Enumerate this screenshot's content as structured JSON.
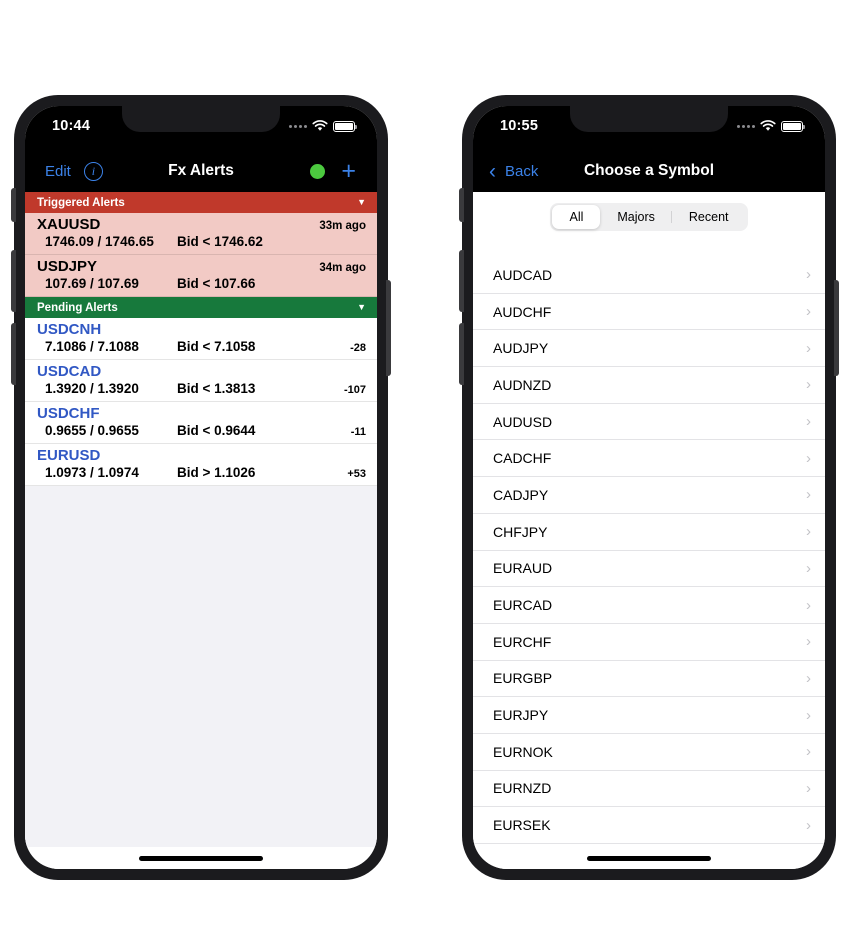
{
  "colors": {
    "triggered_header_bg": "#c0392b",
    "triggered_row_bg": "#f2cac5",
    "pending_header_bg": "#17793c",
    "accent_blue": "#3b82e8",
    "status_dot_green": "#4cc93f",
    "symbol_blue": "#3158c4",
    "page_bg": "#ffffff",
    "list_fill_bg": "#f2f2f6"
  },
  "phone_left": {
    "status_bar": {
      "time": "10:44",
      "signal_icon": "signal-dots-icon",
      "wifi_icon": "wifi-icon",
      "battery_icon": "battery-icon"
    },
    "nav": {
      "edit_label": "Edit",
      "info_icon": "info-circle-icon",
      "info_glyph": "i",
      "title": "Fx Alerts",
      "status_dot_icon": "connection-status-dot-icon",
      "add_label": "+"
    },
    "sections": [
      {
        "id": "triggered",
        "title": "Triggered Alerts",
        "caret": "▼",
        "rows": [
          {
            "symbol": "XAUUSD",
            "ago": "33m ago",
            "price": "1746.09 / 1746.65",
            "condition": "Bid < 1746.62",
            "pips": ""
          },
          {
            "symbol": "USDJPY",
            "ago": "34m ago",
            "price": "107.69 / 107.69",
            "condition": "Bid < 107.66",
            "pips": ""
          }
        ]
      },
      {
        "id": "pending",
        "title": "Pending Alerts",
        "caret": "▼",
        "rows": [
          {
            "symbol": "USDCNH",
            "ago": "",
            "price": "7.1086 / 7.1088",
            "condition": "Bid < 7.1058",
            "pips": "-28"
          },
          {
            "symbol": "USDCAD",
            "ago": "",
            "price": "1.3920 / 1.3920",
            "condition": "Bid < 1.3813",
            "pips": "-107"
          },
          {
            "symbol": "USDCHF",
            "ago": "",
            "price": "0.9655 / 0.9655",
            "condition": "Bid < 0.9644",
            "pips": "-11"
          },
          {
            "symbol": "EURUSD",
            "ago": "",
            "price": "1.0973 / 1.0974",
            "condition": "Bid > 1.1026",
            "pips": "+53"
          }
        ]
      }
    ]
  },
  "phone_right": {
    "status_bar": {
      "time": "10:55",
      "signal_icon": "signal-dots-icon",
      "wifi_icon": "wifi-icon",
      "battery_icon": "battery-icon"
    },
    "nav": {
      "back_label": "Back",
      "back_icon": "chevron-left-icon",
      "title": "Choose a Symbol"
    },
    "filter": {
      "options": [
        "All",
        "Majors",
        "Recent"
      ],
      "selected": "All"
    },
    "symbols": [
      "AUDCAD",
      "AUDCHF",
      "AUDJPY",
      "AUDNZD",
      "AUDUSD",
      "CADCHF",
      "CADJPY",
      "CHFJPY",
      "EURAUD",
      "EURCAD",
      "EURCHF",
      "EURGBP",
      "EURJPY",
      "EURNOK",
      "EURNZD",
      "EURSEK"
    ],
    "row_chevron": "›"
  }
}
